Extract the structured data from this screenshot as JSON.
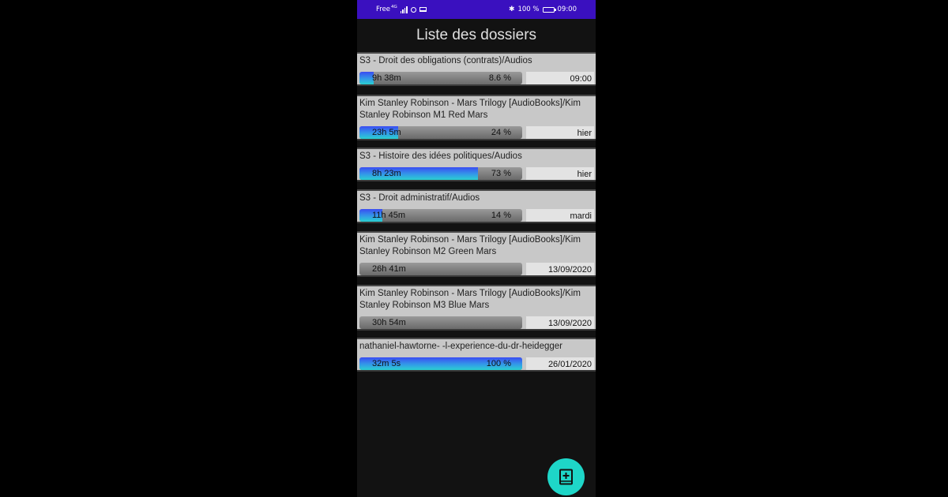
{
  "statusbar": {
    "carrier": "Free",
    "network": "4G",
    "battery_pct": "100 %",
    "time": "09:00"
  },
  "title": "Liste des dossiers",
  "folders": [
    {
      "name": "S3 - Droit des obligations (contrats)/Audios",
      "duration": "9h 38m",
      "percent": "8.6 %",
      "progress": 0.086,
      "date": "09:00",
      "lines": 1
    },
    {
      "name": "Kim Stanley Robinson - Mars Trilogy [AudioBooks]/Kim Stanley Robinson M1 Red Mars",
      "duration": "23h 5m",
      "percent": "24 %",
      "progress": 0.24,
      "date": "hier",
      "lines": 2
    },
    {
      "name": "S3 - Histoire des idées politiques/Audios",
      "duration": "8h 23m",
      "percent": "73 %",
      "progress": 0.73,
      "date": "hier",
      "lines": 1
    },
    {
      "name": "S3 - Droit administratif/Audios",
      "duration": "11h 45m",
      "percent": "14 %",
      "progress": 0.14,
      "date": "mardi",
      "lines": 1
    },
    {
      "name": "Kim Stanley Robinson - Mars Trilogy [AudioBooks]/Kim Stanley Robinson M2 Green Mars",
      "duration": "26h 41m",
      "percent": "",
      "progress": 0,
      "date": "13/09/2020",
      "lines": 2
    },
    {
      "name": "Kim Stanley Robinson - Mars Trilogy [AudioBooks]/Kim Stanley Robinson M3 Blue Mars",
      "duration": "30h 54m",
      "percent": "",
      "progress": 0,
      "date": "13/09/2020",
      "lines": 2
    },
    {
      "name": "nathaniel-hawtorne- -l-experience-du-dr-heidegger",
      "duration": "32m 5s",
      "percent": "100 %",
      "progress": 1.0,
      "date": "26/01/2020",
      "lines": 1
    }
  ],
  "fab": {
    "icon": "add-book-icon"
  }
}
